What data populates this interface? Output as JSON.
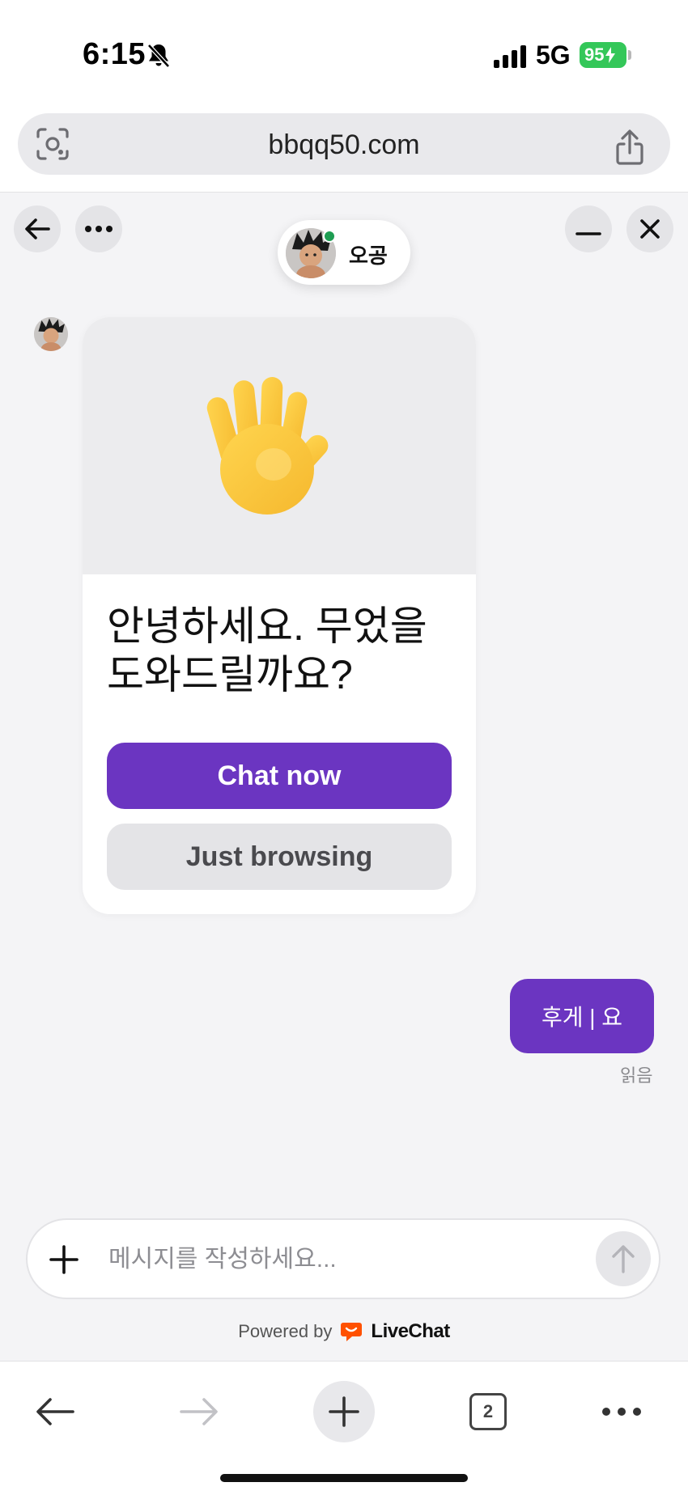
{
  "status_bar": {
    "time": "6:15",
    "network": "5G",
    "battery": "95",
    "icons": [
      "bell-slash-icon",
      "signal-bars-icon",
      "battery-charging-icon"
    ]
  },
  "browser": {
    "url": "bbqq50.com",
    "icons": [
      "camera-lens-icon",
      "share-icon"
    ]
  },
  "chat_header": {
    "agent_name": "오공",
    "agent_status_color": "#1e9d52",
    "icons": [
      "back-arrow-icon",
      "more-dots-icon",
      "minimize-icon",
      "close-icon"
    ]
  },
  "welcome_card": {
    "hero_icon": "waving-hand-icon",
    "title": "안녕하세요. 무었을 도와드릴까요?",
    "primary_button": "Chat now",
    "secondary_button": "Just browsing"
  },
  "visitor_message": {
    "text": "후게 | 요",
    "status": "읽음"
  },
  "composer": {
    "placeholder": "메시지를 작성하세요...",
    "icons": [
      "plus-icon",
      "send-arrow-icon"
    ]
  },
  "branding": {
    "powered_by": "Powered by",
    "name": "LiveChat"
  },
  "toolbar": {
    "tabs_count": "2",
    "icons": [
      "back-icon",
      "forward-icon",
      "new-tab-icon",
      "tabs-icon",
      "menu-dots-icon"
    ]
  },
  "colors": {
    "accent": "#6b35c1",
    "battery": "#34c759",
    "livechat_brand": "#ff5100"
  }
}
